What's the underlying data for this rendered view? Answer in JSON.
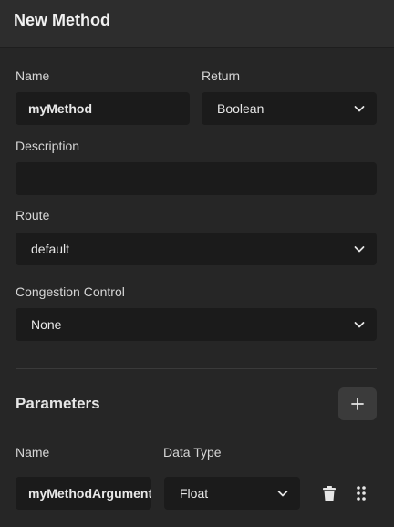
{
  "header": {
    "title": "New Method"
  },
  "form": {
    "name_label": "Name",
    "name_value": "myMethod",
    "return_label": "Return",
    "return_value": "Boolean",
    "description_label": "Description",
    "description_value": "",
    "route_label": "Route",
    "route_value": "default",
    "congestion_label": "Congestion Control",
    "congestion_value": "None"
  },
  "parameters": {
    "title": "Parameters",
    "add_label": "+",
    "name_header": "Name",
    "type_header": "Data Type",
    "rows": [
      {
        "name": "myMethodArgument",
        "type": "Float"
      }
    ]
  },
  "icons": {
    "add": "plus-icon",
    "dropdown": "chevron-down-icon",
    "delete": "trash-icon",
    "drag": "drag-handle-icon"
  }
}
